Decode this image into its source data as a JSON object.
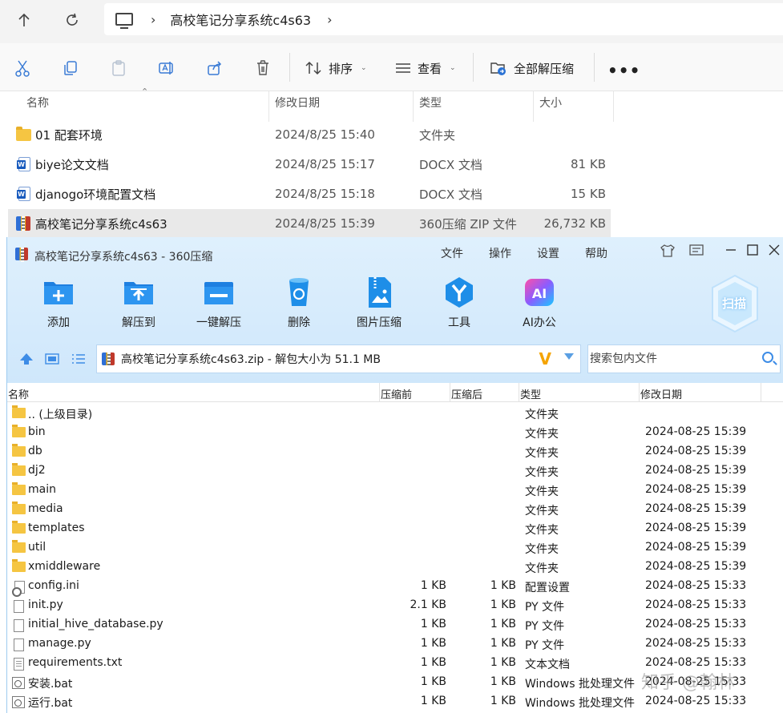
{
  "explorer": {
    "breadcrumb": "高校笔记分享系统c4s63",
    "toolbar": {
      "sort_label": "排序",
      "view_label": "查看",
      "extract_all_label": "全部解压缩",
      "more_label": "•••"
    },
    "columns": {
      "name": "名称",
      "modified": "修改日期",
      "type": "类型",
      "size": "大小"
    },
    "files": [
      {
        "name": "01 配套环境",
        "modified": "2024/8/25 15:40",
        "type": "文件夹",
        "size": "",
        "icon": "folder-icon"
      },
      {
        "name": "biye论文文档",
        "modified": "2024/8/25 15:17",
        "type": "DOCX 文档",
        "size": "81 KB",
        "icon": "word-doc-icon"
      },
      {
        "name": "djanogo环境配置文档",
        "modified": "2024/8/25 15:18",
        "type": "DOCX 文档",
        "size": "15 KB",
        "icon": "word-doc-icon"
      },
      {
        "name": "高校笔记分享系统c4s63",
        "modified": "2024/8/25 15:39",
        "type": "360压缩 ZIP 文件",
        "size": "26,732 KB",
        "icon": "zip-archive-icon"
      }
    ]
  },
  "archiver": {
    "title": "高校笔记分享系统c4s63 - 360压缩",
    "menu": [
      "文件",
      "操作",
      "设置",
      "帮助"
    ],
    "tools": [
      {
        "label": "添加",
        "icon": "add-folder-icon"
      },
      {
        "label": "解压到",
        "icon": "extract-to-icon"
      },
      {
        "label": "一键解压",
        "icon": "one-click-extract-icon"
      },
      {
        "label": "删除",
        "icon": "recycle-bin-icon"
      },
      {
        "label": "图片压缩",
        "icon": "image-compress-icon"
      },
      {
        "label": "工具",
        "icon": "tools-icon"
      },
      {
        "label": "AI办公",
        "icon": "ai-office-icon"
      }
    ],
    "scan_label": "扫描",
    "path": "高校笔记分享系统c4s63.zip - 解包大小为 51.1 MB",
    "search_placeholder": "搜索包内文件",
    "columns": {
      "name": "名称",
      "before": "压缩前",
      "after": "压缩后",
      "type": "类型",
      "modified": "修改日期"
    },
    "rows": [
      {
        "name": ".. (上级目录)",
        "before": "",
        "after": "",
        "type": "文件夹",
        "modified": "",
        "icon": "folder-icon"
      },
      {
        "name": "bin",
        "before": "",
        "after": "",
        "type": "文件夹",
        "modified": "2024-08-25 15:39",
        "icon": "folder-icon"
      },
      {
        "name": "db",
        "before": "",
        "after": "",
        "type": "文件夹",
        "modified": "2024-08-25 15:39",
        "icon": "folder-icon"
      },
      {
        "name": "dj2",
        "before": "",
        "after": "",
        "type": "文件夹",
        "modified": "2024-08-25 15:39",
        "icon": "folder-icon"
      },
      {
        "name": "main",
        "before": "",
        "after": "",
        "type": "文件夹",
        "modified": "2024-08-25 15:39",
        "icon": "folder-icon"
      },
      {
        "name": "media",
        "before": "",
        "after": "",
        "type": "文件夹",
        "modified": "2024-08-25 15:39",
        "icon": "folder-icon"
      },
      {
        "name": "templates",
        "before": "",
        "after": "",
        "type": "文件夹",
        "modified": "2024-08-25 15:39",
        "icon": "folder-icon"
      },
      {
        "name": "util",
        "before": "",
        "after": "",
        "type": "文件夹",
        "modified": "2024-08-25 15:39",
        "icon": "folder-icon"
      },
      {
        "name": "xmiddleware",
        "before": "",
        "after": "",
        "type": "文件夹",
        "modified": "2024-08-25 15:39",
        "icon": "folder-icon"
      },
      {
        "name": "config.ini",
        "before": "1 KB",
        "after": "1 KB",
        "type": "配置设置",
        "modified": "2024-08-25 15:33",
        "icon": "config-file-icon"
      },
      {
        "name": "init.py",
        "before": "2.1 KB",
        "after": "1 KB",
        "type": "PY 文件",
        "modified": "2024-08-25 15:33",
        "icon": "file-icon"
      },
      {
        "name": "initial_hive_database.py",
        "before": "1 KB",
        "after": "1 KB",
        "type": "PY 文件",
        "modified": "2024-08-25 15:33",
        "icon": "file-icon"
      },
      {
        "name": "manage.py",
        "before": "1 KB",
        "after": "1 KB",
        "type": "PY 文件",
        "modified": "2024-08-25 15:33",
        "icon": "file-icon"
      },
      {
        "name": "requirements.txt",
        "before": "1 KB",
        "after": "1 KB",
        "type": "文本文档",
        "modified": "2024-08-25 15:33",
        "icon": "text-file-icon"
      },
      {
        "name": "安装.bat",
        "before": "1 KB",
        "after": "1 KB",
        "type": "Windows 批处理文件",
        "modified": "2024-08-25 15:33",
        "icon": "batch-file-icon"
      },
      {
        "name": "运行.bat",
        "before": "1 KB",
        "after": "1 KB",
        "type": "Windows 批处理文件",
        "modified": "2024-08-25 15:33",
        "icon": "batch-file-icon"
      }
    ]
  },
  "watermark": "知乎 @翰林"
}
